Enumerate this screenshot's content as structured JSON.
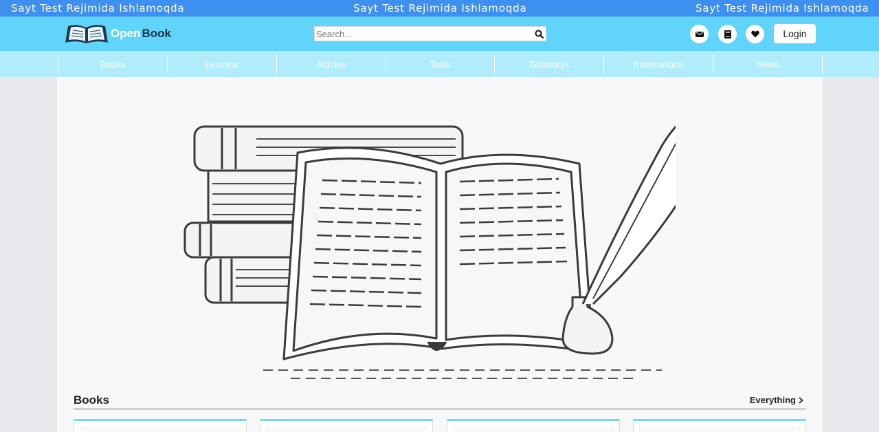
{
  "banner": {
    "messages": [
      "Sayt Test Rejimida Ishlamoqda",
      "Sayt Test Rejimida Ishlamoqda",
      "Sayt Test Rejimida Ishlamoqda"
    ]
  },
  "header": {
    "logo_open": "Open",
    "logo_book": "Book",
    "search_placeholder": "Search...",
    "login_label": "Login",
    "icons": [
      "envelope-icon",
      "book-icon",
      "heart-icon",
      "search-icon"
    ]
  },
  "nav": {
    "items": [
      {
        "label": "Books"
      },
      {
        "label": "Lessons"
      },
      {
        "label": "Articles"
      },
      {
        "label": "Tests"
      },
      {
        "label": "Glassorys"
      },
      {
        "label": "Informations"
      },
      {
        "label": "News"
      }
    ]
  },
  "main": {
    "section_title": "Books",
    "everything_label": "Everything"
  },
  "colors": {
    "banner": "#3d8ff0",
    "header": "#60d4fb",
    "nav": "#b1ecfd",
    "card_accent": "#7ad6f7"
  }
}
